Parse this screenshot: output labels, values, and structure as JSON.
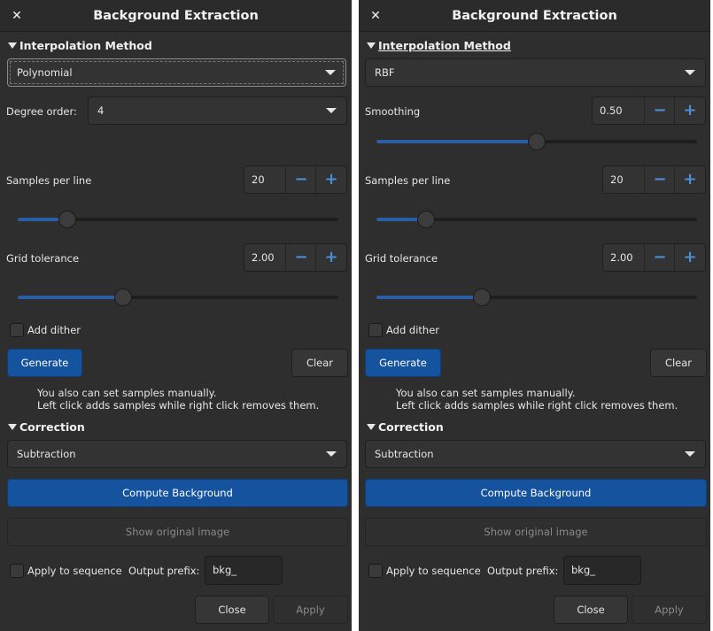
{
  "left": {
    "title": "Background Extraction",
    "interpolation_header": "Interpolation Method",
    "method": "Polynomial",
    "degree_label": "Degree order:",
    "degree_value": "4",
    "samples_label": "Samples per line",
    "samples_value": "20",
    "samples_slider_fraction": 0.155,
    "tolerance_label": "Grid tolerance",
    "tolerance_value": "2.00",
    "tolerance_slider_fraction": 0.33,
    "add_dither_label": "Add dither",
    "generate_label": "Generate",
    "clear_label": "Clear",
    "info_line1": "You also can set samples manually.",
    "info_line2": "Left click adds samples while right click removes them.",
    "correction_header": "Correction",
    "correction_value": "Subtraction",
    "compute_label": "Compute Background",
    "show_original_label": "Show original image",
    "apply_sequence_label": "Apply to sequence",
    "output_prefix_label": "Output prefix:",
    "output_prefix_value": "bkg_",
    "close_label": "Close",
    "apply_label": "Apply"
  },
  "right": {
    "title": "Background Extraction",
    "interpolation_header": "Interpolation Method",
    "method": "RBF",
    "smoothing_label": "Smoothing",
    "smoothing_value": "0.50",
    "smoothing_slider_fraction": 0.5,
    "samples_label": "Samples per line",
    "samples_value": "20",
    "samples_slider_fraction": 0.155,
    "tolerance_label": "Grid tolerance",
    "tolerance_value": "2.00",
    "tolerance_slider_fraction": 0.33,
    "add_dither_label": "Add dither",
    "generate_label": "Generate",
    "clear_label": "Clear",
    "info_line1": "You also can set samples manually.",
    "info_line2": "Left click adds samples while right click removes them.",
    "correction_header": "Correction",
    "correction_value": "Subtraction",
    "compute_label": "Compute Background",
    "show_original_label": "Show original image",
    "apply_sequence_label": "Apply to sequence",
    "output_prefix_label": "Output prefix:",
    "output_prefix_value": "bkg_",
    "close_label": "Close",
    "apply_label": "Apply"
  },
  "icons": {
    "close": "close-icon",
    "minus": "minus-icon",
    "plus": "plus-icon",
    "expander": "expander-down-icon",
    "dropdown": "chevron-down-icon"
  },
  "colors": {
    "dialog_bg": "#2e2e2e",
    "accent": "#15539e",
    "spin_symbol": "#4a90d9",
    "slider_fill": "#2a5fa8"
  }
}
